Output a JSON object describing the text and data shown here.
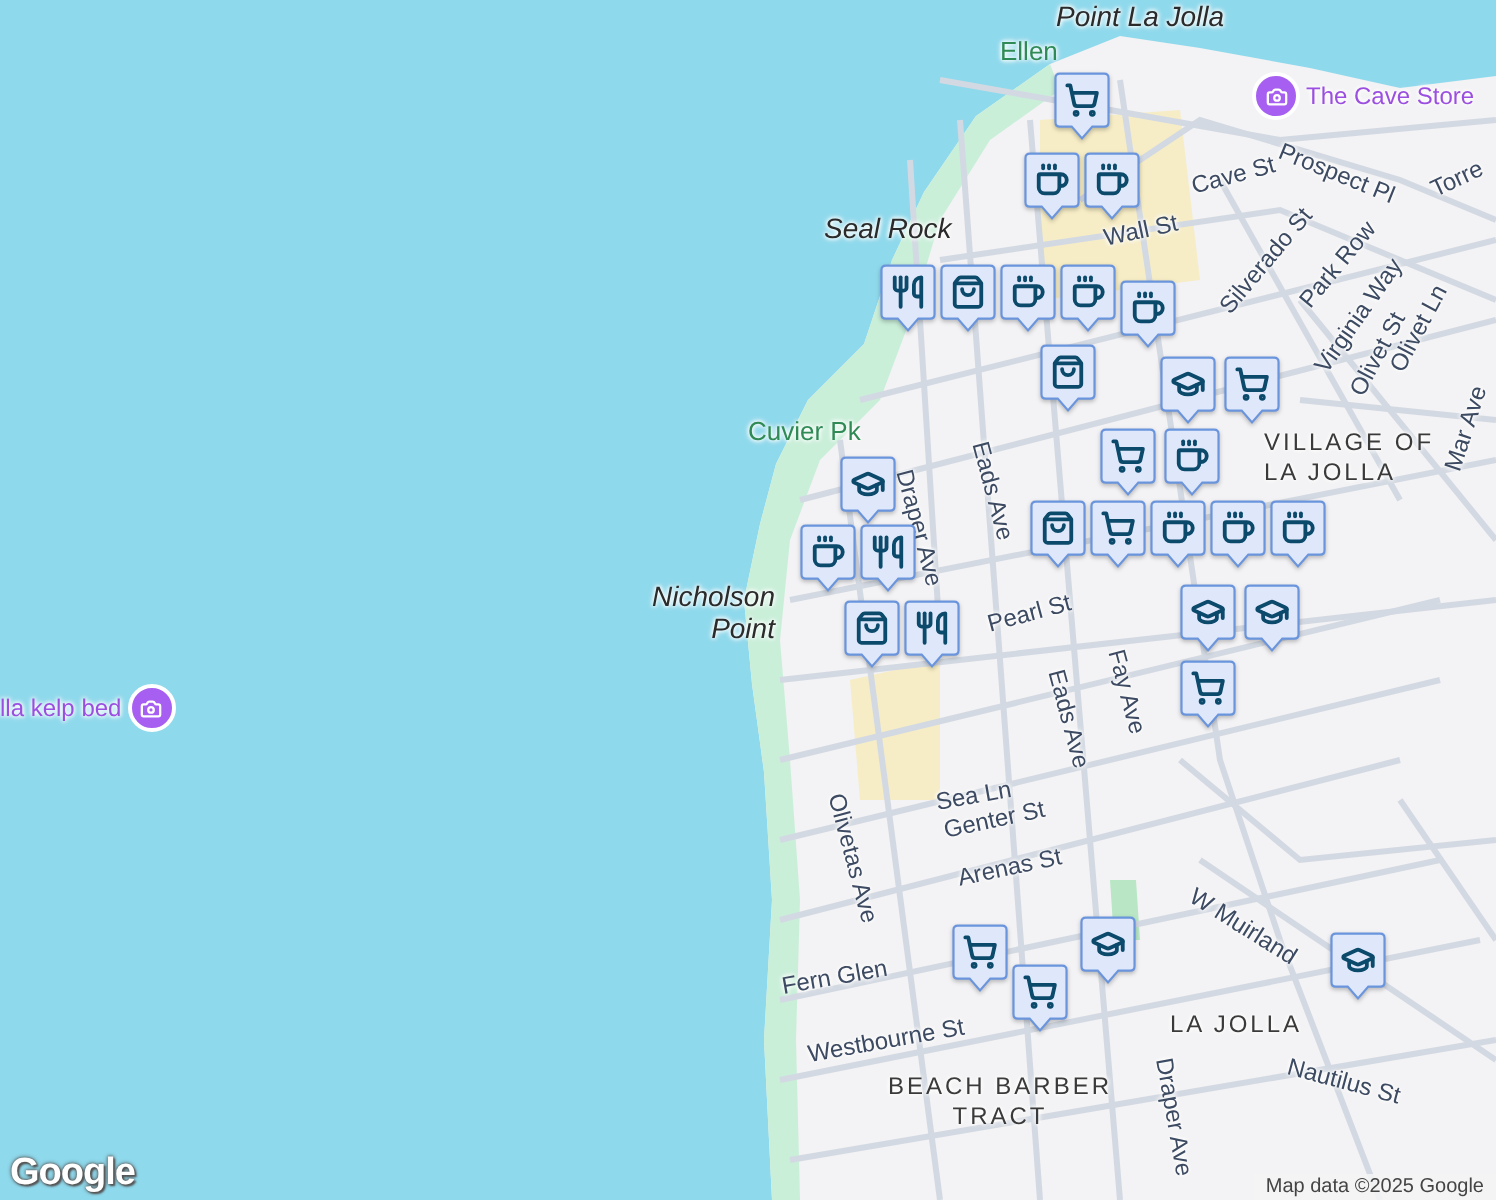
{
  "map": {
    "labels": [
      {
        "text": "Point La Jolla",
        "kind": "place"
      },
      {
        "text": "Ellen",
        "kind": "park"
      },
      {
        "text": "The Cave Store",
        "kind": "poi"
      },
      {
        "text": "Prospect Pl",
        "kind": "street"
      },
      {
        "text": "Torre",
        "kind": "street"
      },
      {
        "text": "Cave St",
        "kind": "street"
      },
      {
        "text": "Wall St",
        "kind": "street"
      },
      {
        "text": "Silverado St",
        "kind": "street"
      },
      {
        "text": "Park Row",
        "kind": "street"
      },
      {
        "text": "Seal Rock",
        "kind": "place"
      },
      {
        "text": "Virginia Way",
        "kind": "street"
      },
      {
        "text": "Olivet St",
        "kind": "street"
      },
      {
        "text": "Olivet Ln",
        "kind": "street"
      },
      {
        "text": "Mar Ave",
        "kind": "street"
      },
      {
        "text": "Cuvier Pk",
        "kind": "park"
      },
      {
        "text": "Draper Ave",
        "kind": "street"
      },
      {
        "text": "Eads Ave",
        "kind": "street"
      },
      {
        "text": "VILLAGE OF LA JOLLA",
        "kind": "area"
      },
      {
        "text": "Nicholson Point",
        "kind": "place"
      },
      {
        "text": "Pearl St",
        "kind": "street"
      },
      {
        "text": "Eads Ave",
        "kind": "street"
      },
      {
        "text": "Fay Ave",
        "kind": "street"
      },
      {
        "text": "Olivetas Ave",
        "kind": "street"
      },
      {
        "text": "Sea Ln",
        "kind": "street"
      },
      {
        "text": "Genter St",
        "kind": "street"
      },
      {
        "text": "Arenas St",
        "kind": "street"
      },
      {
        "text": "Fern Glen",
        "kind": "street"
      },
      {
        "text": "W Muirland",
        "kind": "street"
      },
      {
        "text": "LA JOLLA",
        "kind": "area"
      },
      {
        "text": "Nautilus St",
        "kind": "street"
      },
      {
        "text": "Westbourne St",
        "kind": "street"
      },
      {
        "text": "BEACH BARBER TRACT",
        "kind": "area"
      },
      {
        "text": "Draper Ave",
        "kind": "street"
      },
      {
        "text": "lla kelp bed",
        "kind": "poi"
      }
    ],
    "markers": [
      {
        "kind": "grocery"
      },
      {
        "kind": "cafe"
      },
      {
        "kind": "cafe"
      },
      {
        "kind": "restaurant"
      },
      {
        "kind": "shopping"
      },
      {
        "kind": "cafe"
      },
      {
        "kind": "cafe"
      },
      {
        "kind": "cafe"
      },
      {
        "kind": "school"
      },
      {
        "kind": "grocery"
      },
      {
        "kind": "shopping"
      },
      {
        "kind": "school"
      },
      {
        "kind": "grocery"
      },
      {
        "kind": "cafe"
      },
      {
        "kind": "shopping"
      },
      {
        "kind": "grocery"
      },
      {
        "kind": "cafe"
      },
      {
        "kind": "cafe"
      },
      {
        "kind": "cafe"
      },
      {
        "kind": "restaurant"
      },
      {
        "kind": "restaurant"
      },
      {
        "kind": "cafe"
      },
      {
        "kind": "school"
      },
      {
        "kind": "school"
      },
      {
        "kind": "shopping"
      },
      {
        "kind": "grocery"
      },
      {
        "kind": "school"
      },
      {
        "kind": "school"
      },
      {
        "kind": "grocery"
      },
      {
        "kind": "grocery"
      }
    ]
  },
  "logo": "Google",
  "attribution": "Map data ©2025 Google"
}
